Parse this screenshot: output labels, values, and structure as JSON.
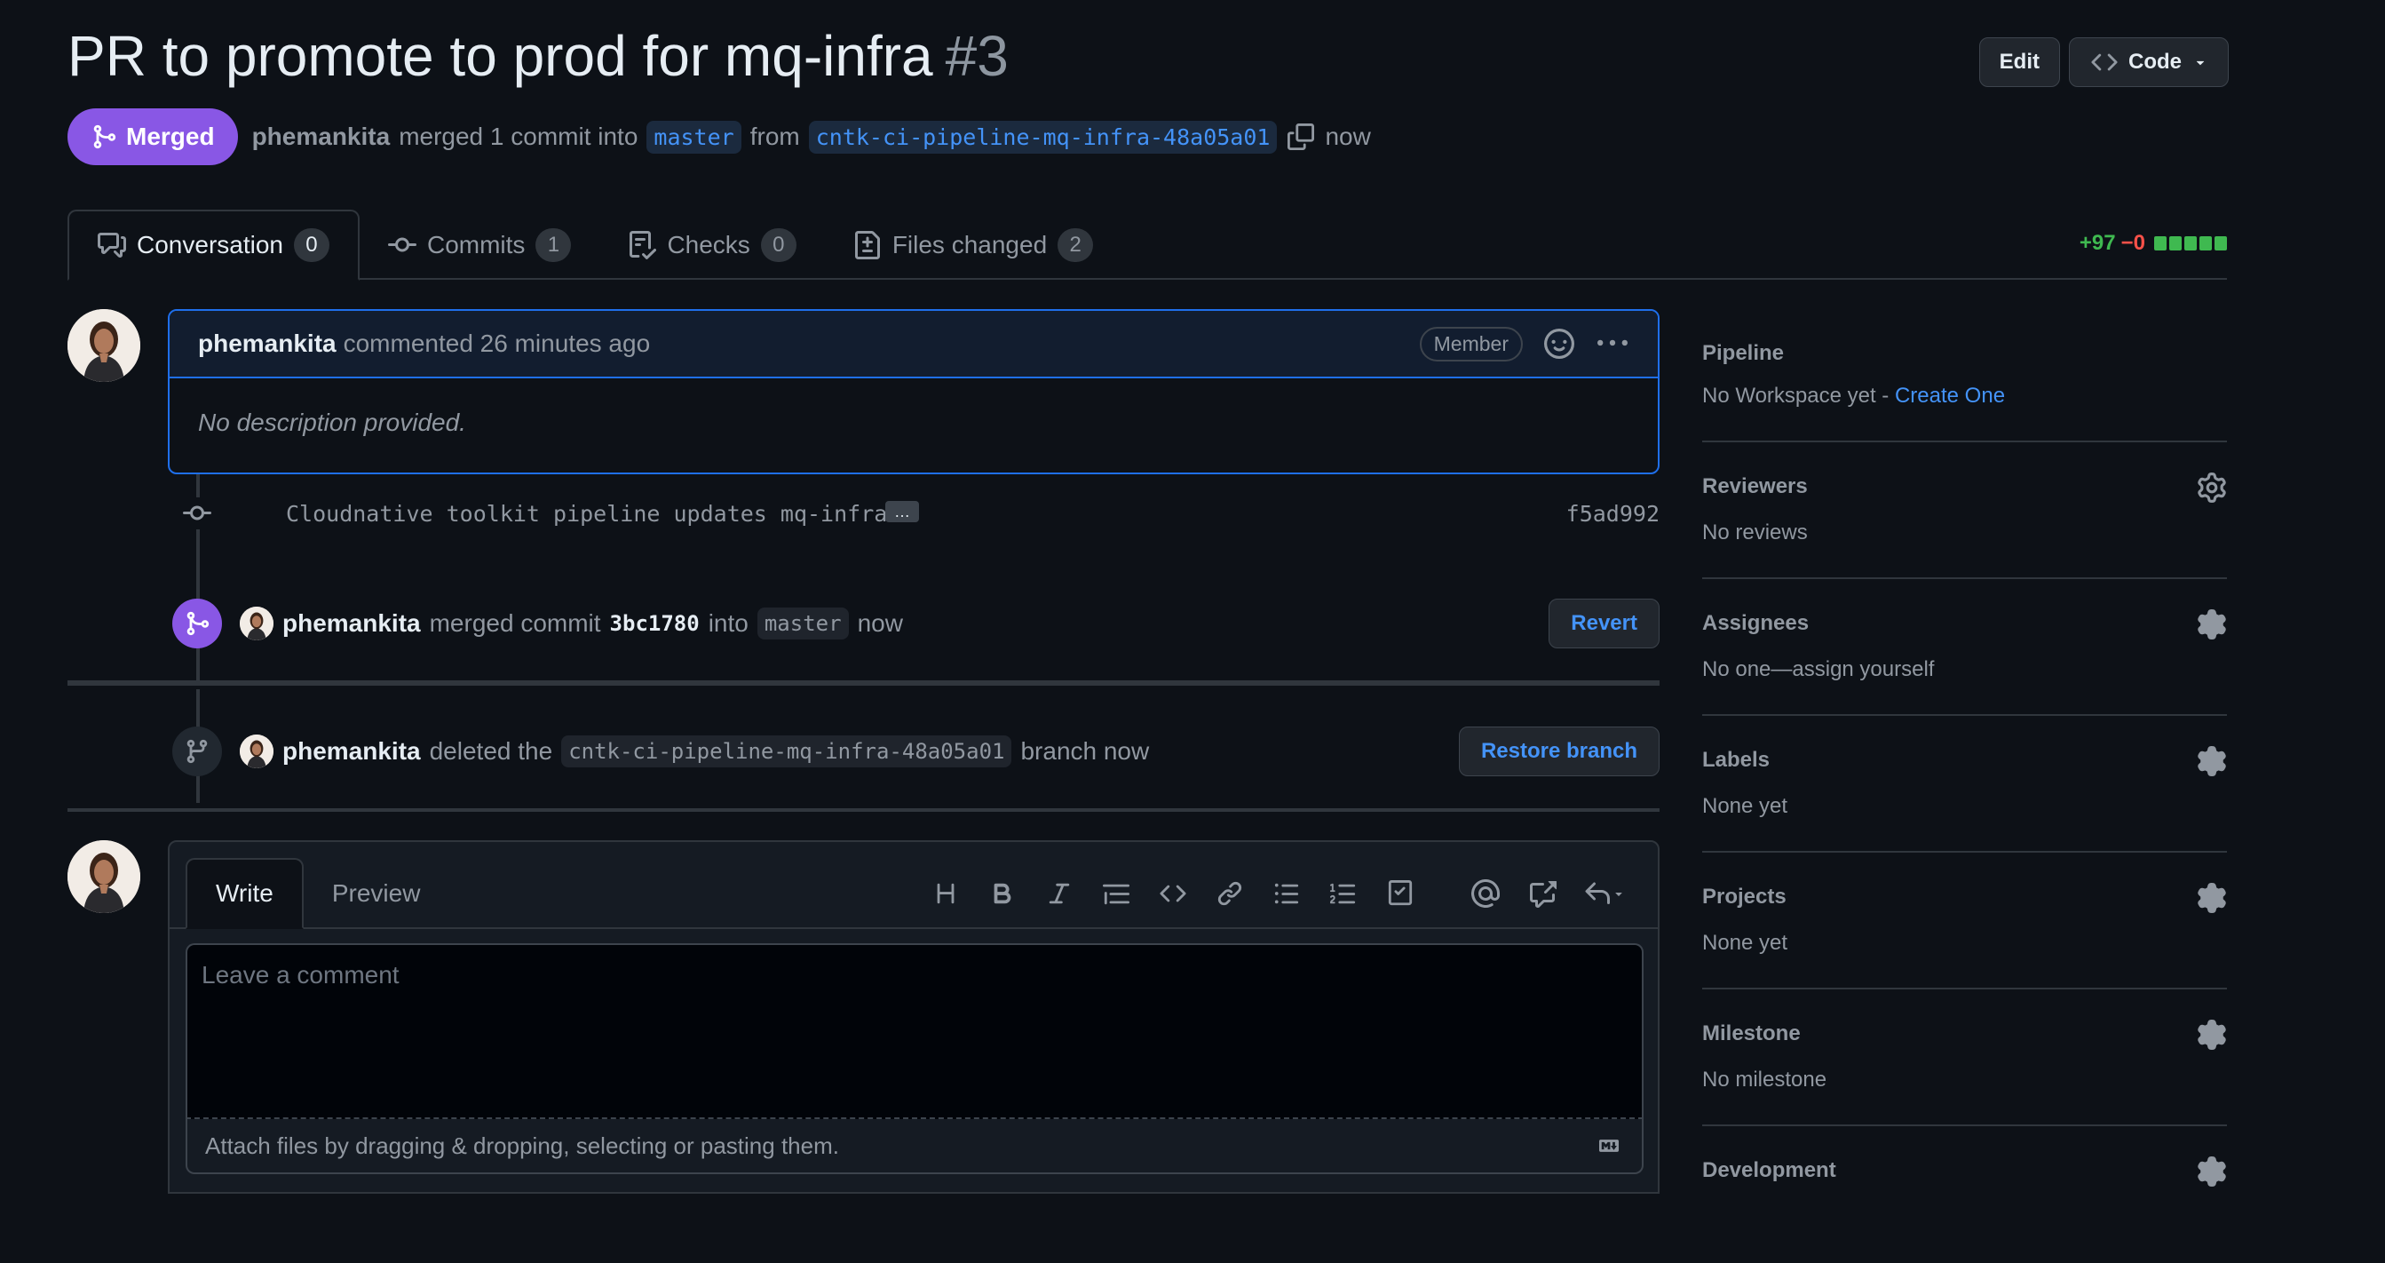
{
  "header": {
    "title": "PR to promote to prod for mq-infra",
    "number": "#3",
    "edit_label": "Edit",
    "code_label": "Code"
  },
  "status": {
    "badge": "Merged",
    "author": "phemankita",
    "merged_text": "merged 1 commit into",
    "base_branch": "master",
    "from_text": "from",
    "head_branch": "cntk-ci-pipeline-mq-infra-48a05a01",
    "time": "now"
  },
  "tabs": [
    {
      "label": "Conversation",
      "count": "0"
    },
    {
      "label": "Commits",
      "count": "1"
    },
    {
      "label": "Checks",
      "count": "0"
    },
    {
      "label": "Files changed",
      "count": "2"
    }
  ],
  "diffstat": {
    "additions": "+97",
    "deletions": "−0"
  },
  "comment": {
    "author": "phemankita",
    "action": "commented 26 minutes ago",
    "badge": "Member",
    "body": "No description provided."
  },
  "commit": {
    "message": "Cloudnative toolkit pipeline updates mq-infra",
    "ellipsis": "…",
    "sha": "f5ad992"
  },
  "merge_event": {
    "author": "phemankita",
    "text": "merged commit",
    "sha": "3bc1780",
    "into": "into",
    "branch": "master",
    "time": "now",
    "button": "Revert"
  },
  "delete_event": {
    "author": "phemankita",
    "text": "deleted the",
    "branch": "cntk-ci-pipeline-mq-infra-48a05a01",
    "suffix": "branch now",
    "button": "Restore branch"
  },
  "editor": {
    "write_tab": "Write",
    "preview_tab": "Preview",
    "placeholder": "Leave a comment",
    "attach_text": "Attach files by dragging & dropping, selecting or pasting them."
  },
  "sidebar": {
    "pipeline": {
      "title": "Pipeline",
      "text": "No Workspace yet - ",
      "link": "Create One"
    },
    "reviewers": {
      "title": "Reviewers",
      "value": "No reviews"
    },
    "assignees": {
      "title": "Assignees",
      "value": "No one—assign yourself"
    },
    "labels": {
      "title": "Labels",
      "value": "None yet"
    },
    "projects": {
      "title": "Projects",
      "value": "None yet"
    },
    "milestone": {
      "title": "Milestone",
      "value": "No milestone"
    },
    "development": {
      "title": "Development"
    }
  },
  "colors": {
    "merged": "#8957e5",
    "accent_blue": "#4493f8",
    "additions": "#3fb950",
    "deletions": "#f85149"
  }
}
